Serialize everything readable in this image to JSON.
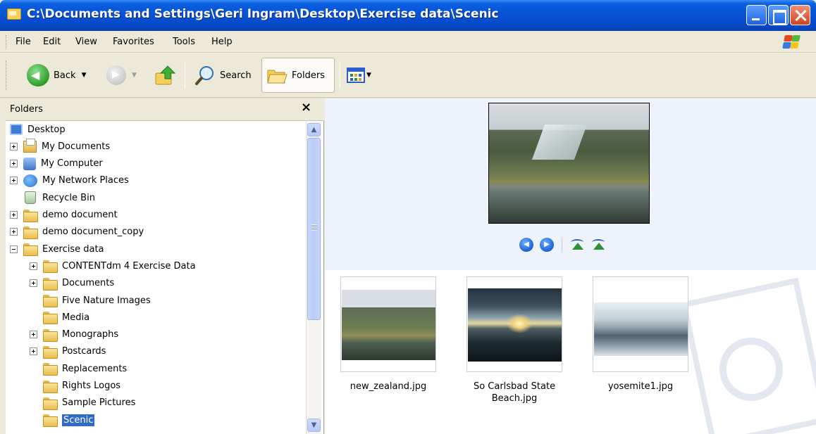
{
  "window": {
    "title": "C:\\Documents and Settings\\Geri Ingram\\Desktop\\Exercise data\\Scenic"
  },
  "menu": [
    "File",
    "Edit",
    "View",
    "Favorites",
    "Tools",
    "Help"
  ],
  "toolbar": {
    "back_label": "Back",
    "search_label": "Search",
    "folders_label": "Folders"
  },
  "folder_pane": {
    "title": "Folders",
    "close_glyph": "×",
    "tree": [
      {
        "label": "Desktop",
        "icon": "desktop-icon",
        "level": 0,
        "expander": "none"
      },
      {
        "label": "My Documents",
        "icon": "my-documents-icon",
        "level": 1,
        "expander": "plus"
      },
      {
        "label": "My Computer",
        "icon": "my-computer-icon",
        "level": 1,
        "expander": "plus"
      },
      {
        "label": "My Network Places",
        "icon": "network-places-icon",
        "level": 1,
        "expander": "plus"
      },
      {
        "label": "Recycle Bin",
        "icon": "recycle-bin-icon",
        "level": 1,
        "expander": "none"
      },
      {
        "label": "demo document",
        "icon": "folder-icon",
        "level": 1,
        "expander": "plus"
      },
      {
        "label": "demo document_copy",
        "icon": "folder-icon",
        "level": 1,
        "expander": "plus"
      },
      {
        "label": "Exercise data",
        "icon": "folder-icon",
        "level": 1,
        "expander": "minus"
      },
      {
        "label": "CONTENTdm 4 Exercise Data",
        "icon": "folder-icon",
        "level": 2,
        "expander": "plus"
      },
      {
        "label": "Documents",
        "icon": "folder-icon",
        "level": 2,
        "expander": "plus"
      },
      {
        "label": "Five Nature Images",
        "icon": "folder-icon",
        "level": 2,
        "expander": "none"
      },
      {
        "label": "Media",
        "icon": "folder-icon",
        "level": 2,
        "expander": "none"
      },
      {
        "label": "Monographs",
        "icon": "folder-icon",
        "level": 2,
        "expander": "plus"
      },
      {
        "label": "Postcards",
        "icon": "folder-icon",
        "level": 2,
        "expander": "plus"
      },
      {
        "label": "Replacements",
        "icon": "folder-icon",
        "level": 2,
        "expander": "none"
      },
      {
        "label": "Rights Logos",
        "icon": "folder-icon",
        "level": 2,
        "expander": "none"
      },
      {
        "label": "Sample Pictures",
        "icon": "folder-icon",
        "level": 2,
        "expander": "none"
      },
      {
        "label": "Scenic",
        "icon": "folder-open-icon",
        "level": 2,
        "expander": "none",
        "selected": true
      }
    ]
  },
  "files": [
    {
      "name": "new_zealand.jpg"
    },
    {
      "name": "So Carlsbad State Beach.jpg"
    },
    {
      "name": "yosemite1.jpg"
    }
  ],
  "colors": {
    "titlebar": "#0a5fe0",
    "selection": "#316ac5",
    "preview_background": "#eef2fb"
  }
}
